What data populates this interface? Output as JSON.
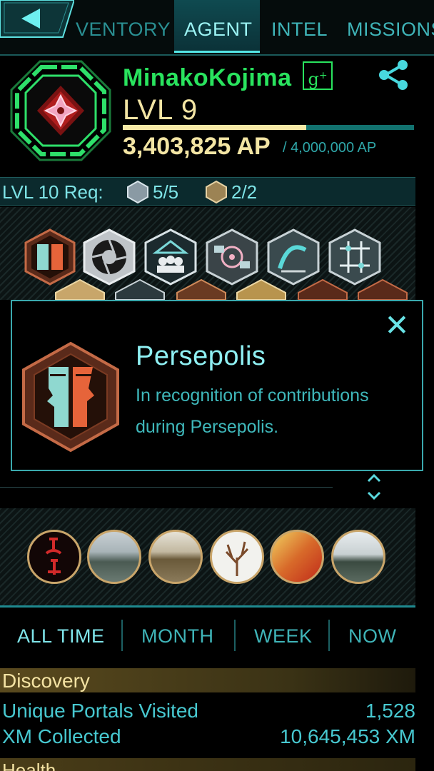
{
  "nav": {
    "tabs": [
      {
        "label": "VENTORY"
      },
      {
        "label": "AGENT"
      },
      {
        "label": "INTEL"
      },
      {
        "label": "MISSIONS"
      }
    ],
    "active_tab": "AGENT"
  },
  "agent": {
    "name": "MinakoKojima",
    "level": "LVL 9",
    "ap": "3,403,825 AP",
    "ap_max": "/ 4,000,000 AP",
    "ap_progress": 0.63,
    "faction_color": "#29e35e"
  },
  "requirements": {
    "label": "LVL 10 Req:",
    "silver": "5/5",
    "gold": "2/2"
  },
  "medals": [
    {
      "icon": "persepolis-medal-icon"
    },
    {
      "icon": "translator-medal-icon"
    },
    {
      "icon": "seer-medal-icon"
    },
    {
      "icon": "connector-medal-icon"
    },
    {
      "icon": "recharger-medal-icon"
    },
    {
      "icon": "mind-controller-medal-icon"
    }
  ],
  "popup": {
    "title": "Persepolis",
    "description": "In recognition of contributions during Persepolis."
  },
  "avatars": [
    {
      "icon": "calligraphy-avatar"
    },
    {
      "icon": "river-avatar"
    },
    {
      "icon": "bronze-cauldron-avatar"
    },
    {
      "icon": "bare-tree-avatar"
    },
    {
      "icon": "calligraphy-banner-avatar"
    },
    {
      "icon": "lake-avatar"
    }
  ],
  "time_tabs": [
    "ALL TIME",
    "MONTH",
    "WEEK",
    "NOW"
  ],
  "stats": {
    "section_discovery": "Discovery",
    "rows": [
      {
        "label": "Unique Portals Visited",
        "value": "1,528"
      },
      {
        "label": "XM Collected",
        "value": "10,645,453 XM"
      }
    ],
    "section_health": "Health"
  }
}
